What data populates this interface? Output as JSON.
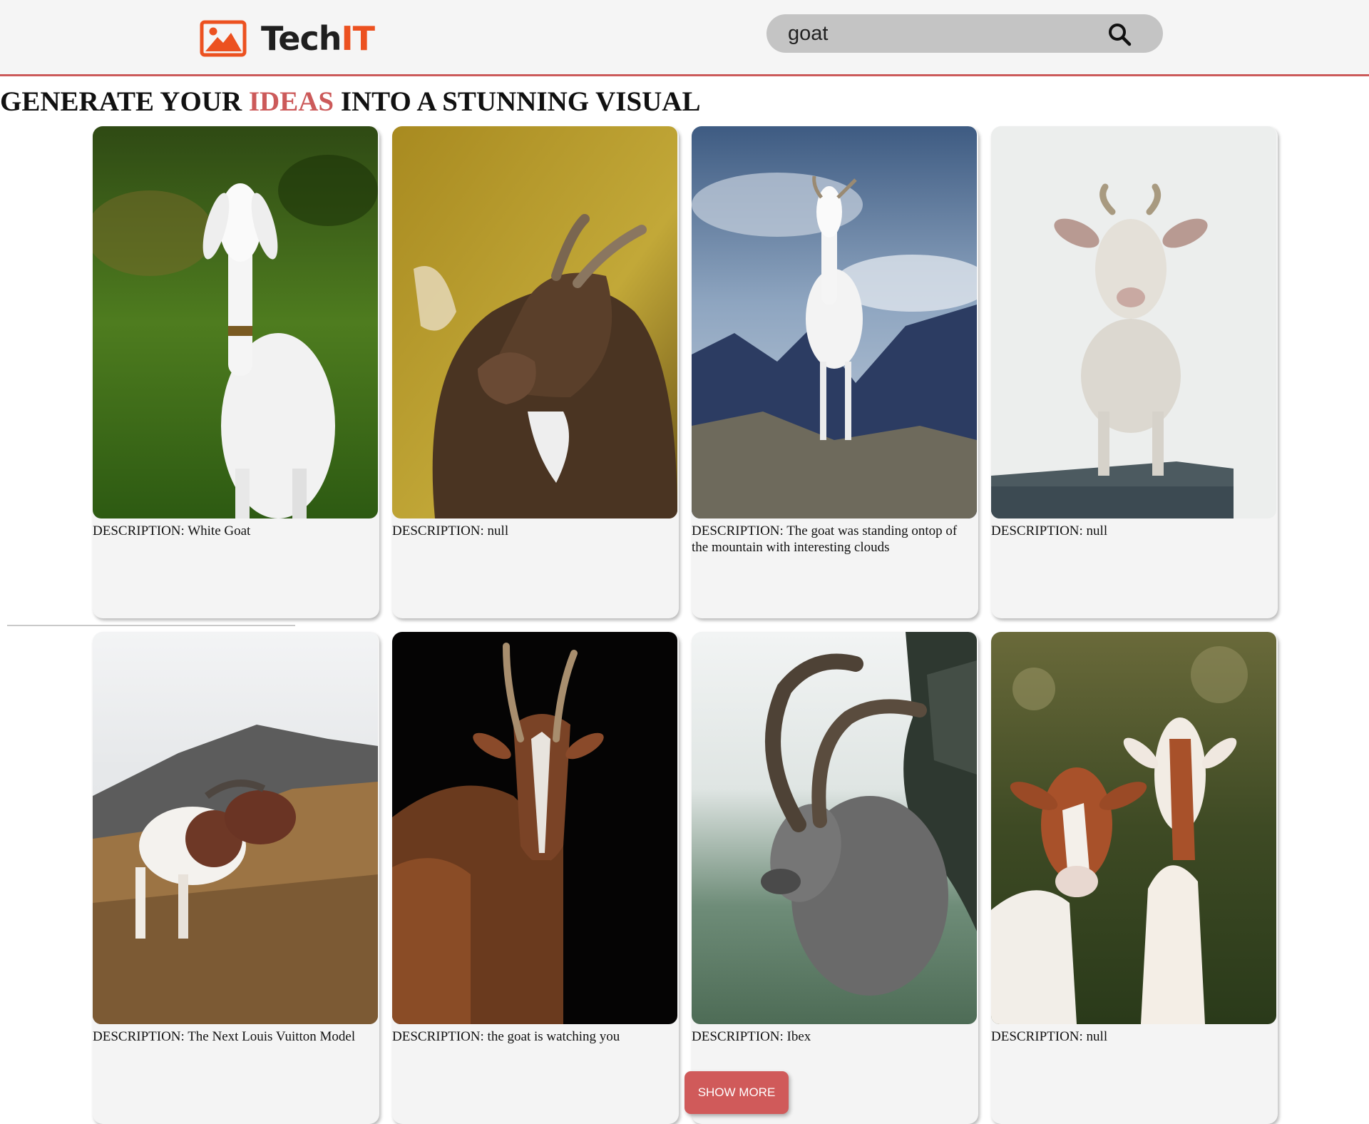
{
  "header": {
    "logo_icon": "image-icon",
    "logo_text_main": "Tech",
    "logo_text_accent": "IT",
    "search": {
      "value": "goat",
      "icon": "search-icon"
    }
  },
  "hero": {
    "part1": "GENERATE YOUR ",
    "accent": "IDEAS",
    "part2": " INTO A STUNNING VISUAL"
  },
  "description_prefix": "DESCRIPTION: ",
  "cards": [
    {
      "description": "White Goat",
      "image": "White goat on green grass"
    },
    {
      "description": "null",
      "image": "Brown goat with curved horns in golden meadow"
    },
    {
      "description": "The goat was standing ontop of the mountain with interesting clouds",
      "image": "White goat on mountain rock under cloudy sky"
    },
    {
      "description": "null",
      "image": "White goat standing on ledge against pale sky"
    },
    {
      "description": "The Next Louis Vuitton Model",
      "image": "Brown and white goat grazing on hillside"
    },
    {
      "description": "the goat is watching you",
      "image": "Brown goat with long horns on black background"
    },
    {
      "description": "Ibex",
      "image": "Ibex with large curved horns near pine tree"
    },
    {
      "description": "null",
      "image": "Two brown and white goats in forest"
    }
  ],
  "show_more_label": "SHOW MORE",
  "colors": {
    "accent": "#cc5a5a",
    "logo_orange": "#ec5120",
    "search_bg": "#c4c4c4",
    "header_bg": "#f5f5f5"
  }
}
